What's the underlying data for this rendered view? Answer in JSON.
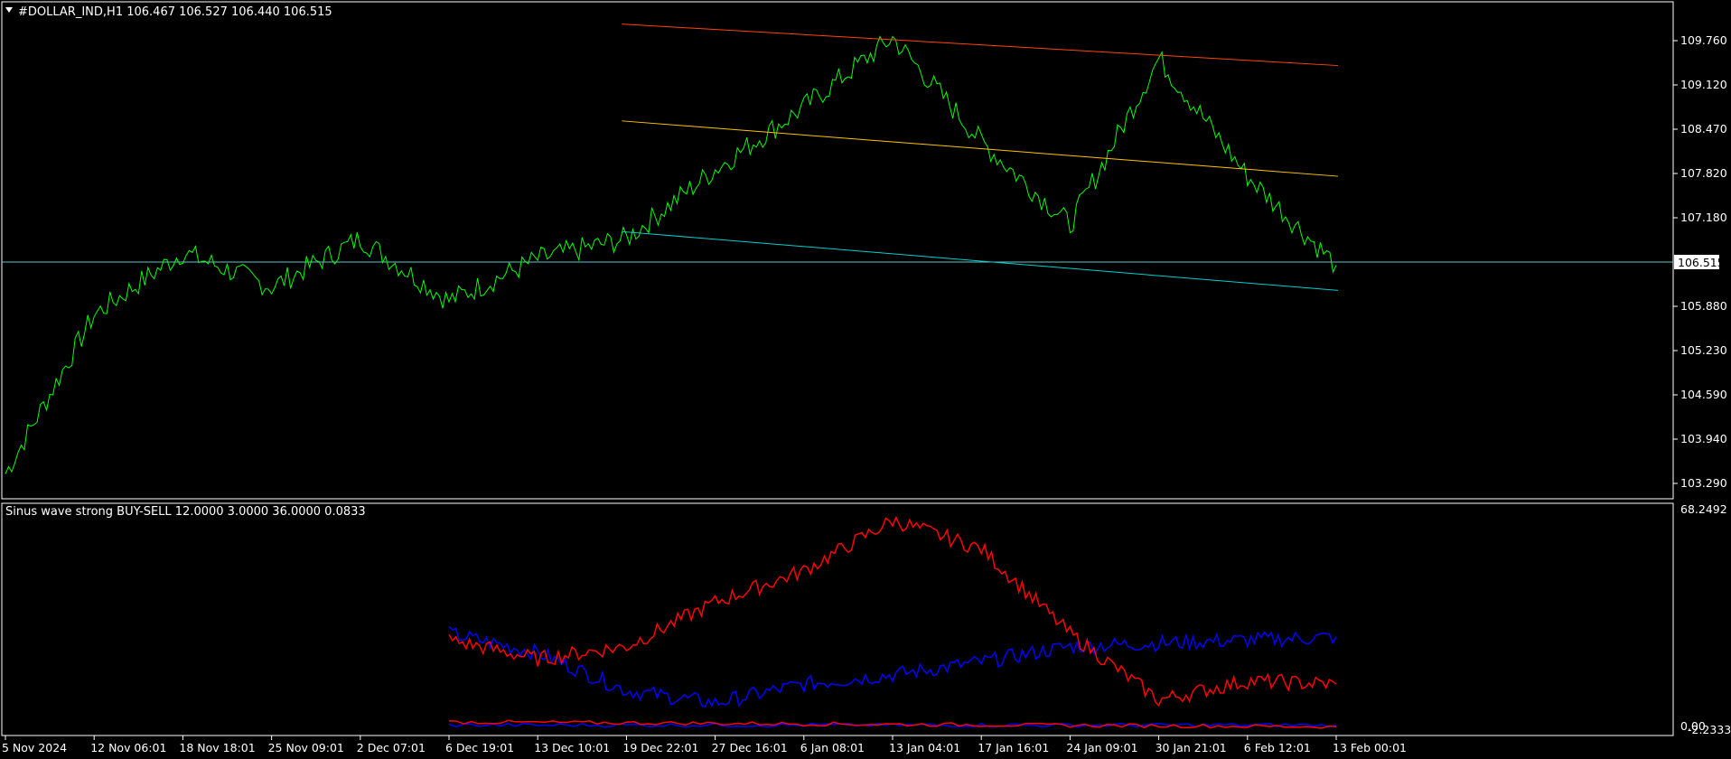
{
  "main_panel": {
    "symbol_header": "#DOLLAR_IND,H1  106.467 106.527 106.440 106.515",
    "price_axis_labels": [
      "109.760",
      "109.120",
      "108.470",
      "107.820",
      "107.180",
      "106.515",
      "105.880",
      "105.230",
      "104.590",
      "103.940",
      "103.290"
    ],
    "current_price_label": "106.515",
    "colors": {
      "background": "#000000",
      "price_line": "#00ff00",
      "upper_channel": "#ff4500",
      "middle_channel": "#ffc400",
      "lower_channel": "#00ced1",
      "current_price_line": "#5fc8c8",
      "axis": "#ffffff"
    }
  },
  "indicator_panel": {
    "title": "Sinus wave strong BUY-SELL 12.0000 3.0000 36.0000 0.0833",
    "axis_top_label": "68.2492",
    "axis_bottom_label": "0.00",
    "axis_bottom_label_2": "-2.2333",
    "colors": {
      "blue_line": "#0000ff",
      "red_line": "#ff0000"
    }
  },
  "time_axis_labels": [
    "5 Nov 2024",
    "12 Nov 06:01",
    "18 Nov 18:01",
    "25 Nov 09:01",
    "2 Dec 07:01",
    "6 Dec 19:01",
    "13 Dec 10:01",
    "19 Dec 22:01",
    "27 Dec 16:01",
    "6 Jan 08:01",
    "13 Jan 04:01",
    "17 Jan 16:01",
    "24 Jan 09:01",
    "30 Jan 21:01",
    "6 Feb 12:01",
    "13 Feb 00:01"
  ],
  "chart_data": [
    {
      "type": "line",
      "series": [
        {
          "name": "#DOLLAR_IND,H1",
          "x": [
            0,
            1,
            2,
            3,
            4,
            5,
            6,
            7,
            8,
            9,
            10,
            11,
            12,
            13,
            14,
            15
          ],
          "values": [
            103.5,
            105.8,
            106.7,
            106.2,
            106.9,
            106.0,
            106.6,
            106.9,
            107.9,
            108.8,
            109.8,
            108.3,
            107.1,
            109.5,
            107.8,
            106.515
          ]
        }
      ],
      "x_tick_labels": [
        "5 Nov 2024",
        "12 Nov 06:01",
        "18 Nov 18:01",
        "25 Nov 09:01",
        "2 Dec 07:01",
        "6 Dec 19:01",
        "13 Dec 10:01",
        "19 Dec 22:01",
        "27 Dec 16:01",
        "6 Jan 08:01",
        "13 Jan 04:01",
        "17 Jan 16:01",
        "24 Jan 09:01",
        "30 Jan 21:01",
        "6 Feb 12:01",
        "13 Feb 00:01"
      ],
      "ylim": [
        103.1,
        110.2
      ],
      "channel": {
        "upper": [
          110.0,
          109.4
        ],
        "middle": [
          108.6,
          107.8
        ],
        "lower": [
          107.0,
          106.15
        ],
        "x_range": [
          7,
          15
        ]
      }
    },
    {
      "type": "line",
      "series": [
        {
          "name": "blue",
          "x": [
            5,
            6,
            7,
            8,
            9,
            10,
            11,
            12,
            13,
            14,
            15
          ],
          "values": [
            30,
            24,
            12,
            8,
            14,
            17,
            21,
            26,
            27,
            28,
            29
          ]
        },
        {
          "name": "red",
          "x": [
            5,
            6,
            7,
            8,
            9,
            10,
            11,
            12,
            13,
            14,
            15
          ],
          "values": [
            28,
            22,
            26,
            40,
            50,
            66,
            57,
            30,
            9,
            15,
            14
          ]
        }
      ],
      "ylim": [
        -2.2333,
        68.2492
      ]
    }
  ]
}
